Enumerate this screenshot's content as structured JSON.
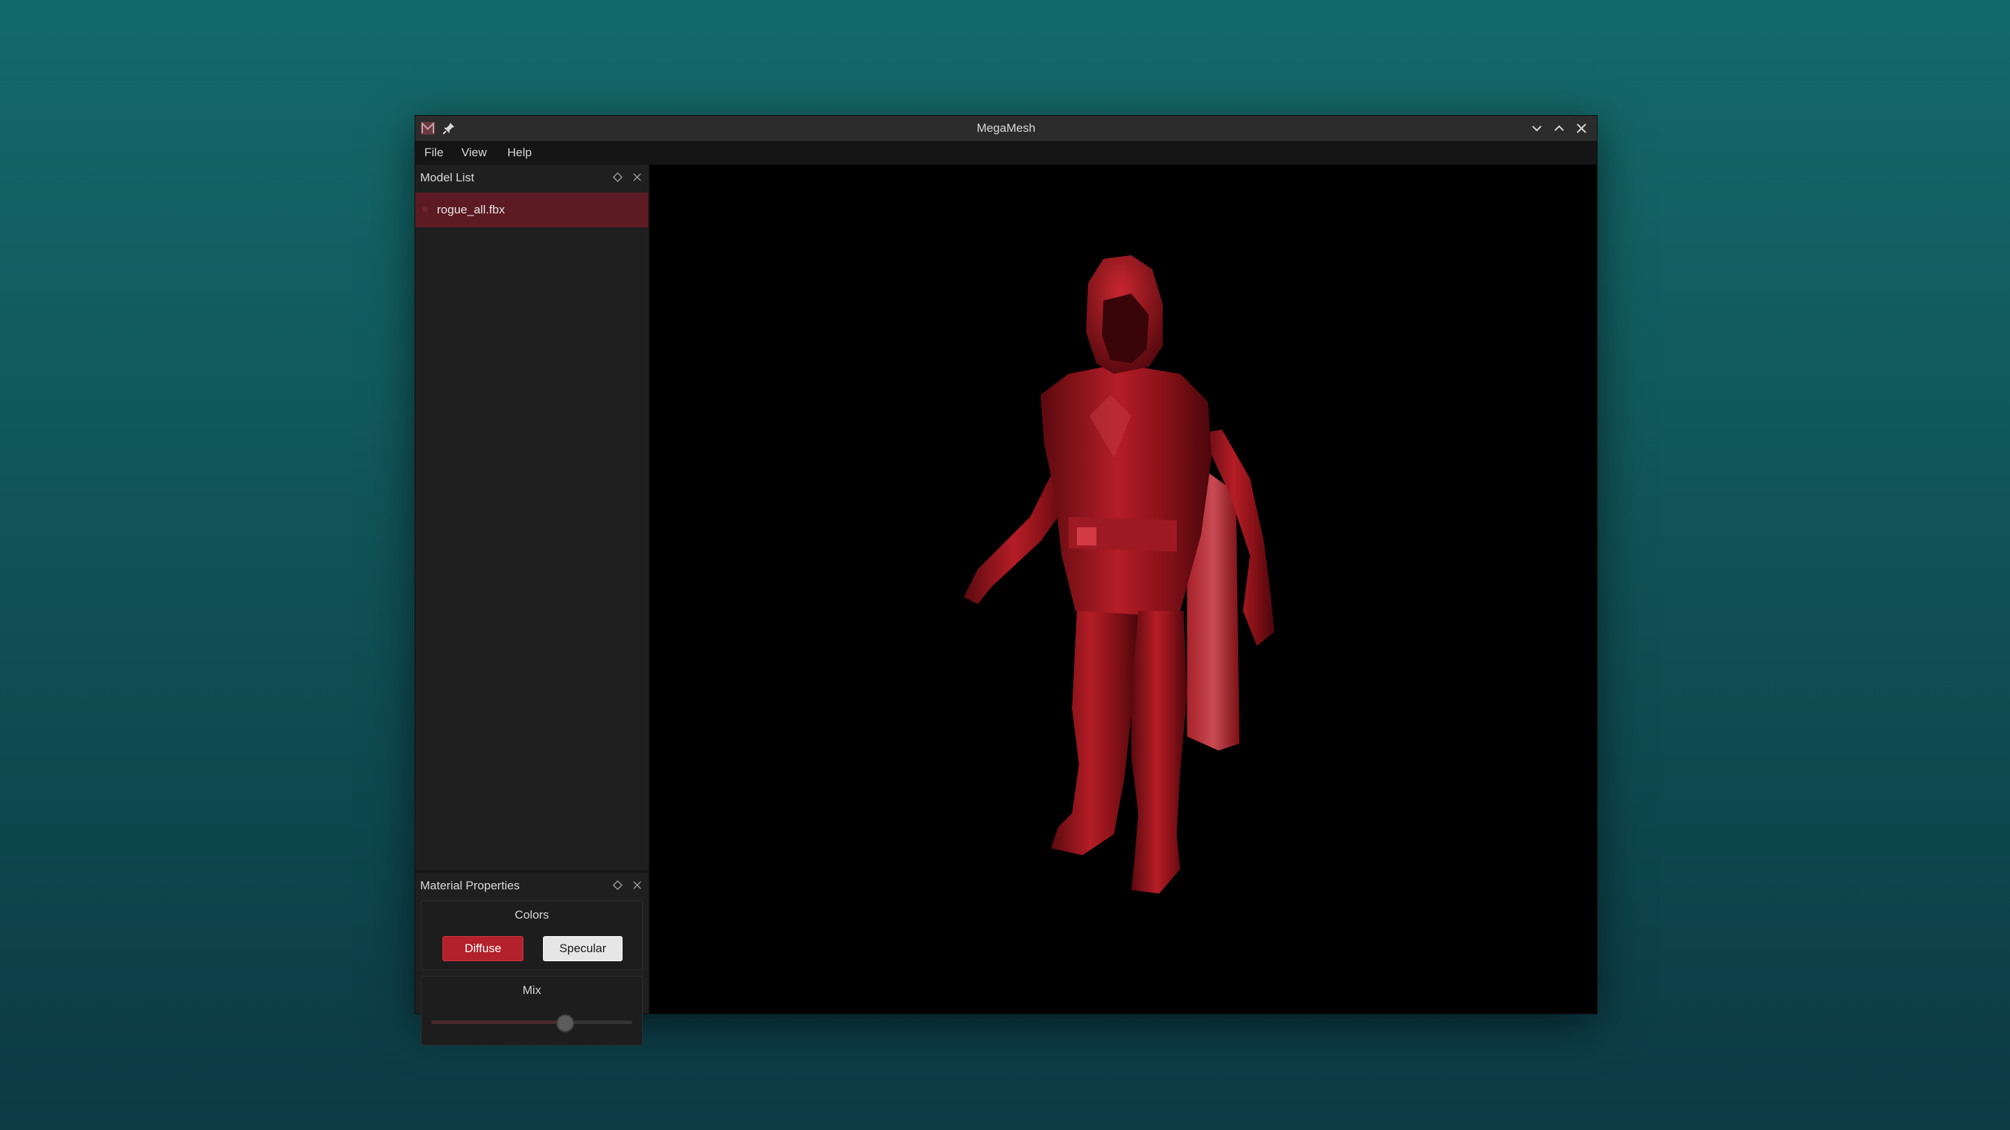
{
  "window": {
    "title": "MegaMesh",
    "icons": {
      "app": "app-logo-icon",
      "pin": "pin-icon",
      "minimize": "chevron-down-icon",
      "maximize": "chevron-up-icon",
      "close": "close-icon"
    }
  },
  "menu": {
    "items": [
      {
        "label": "File"
      },
      {
        "label": "View"
      },
      {
        "label": "Help"
      }
    ]
  },
  "model_list": {
    "title": "Model List",
    "items": [
      {
        "name": "rogue_all.fbx",
        "selected": true
      }
    ],
    "icons": {
      "float": "float-panel-icon",
      "close": "close-icon"
    }
  },
  "material_properties": {
    "title": "Material Properties",
    "colors": {
      "title": "Colors",
      "diffuse_label": "Diffuse",
      "specular_label": "Specular"
    },
    "mix": {
      "title": "Mix",
      "value": 0.66
    },
    "icons": {
      "float": "float-panel-icon",
      "close": "close-icon"
    }
  },
  "viewport": {
    "model_color": "#b01c24",
    "background": "#000000"
  },
  "theme": {
    "accent": "#b3222b",
    "selection": "#5c1a23",
    "desktop_top": "#146a6b",
    "desktop_bottom": "#0c3a45"
  }
}
